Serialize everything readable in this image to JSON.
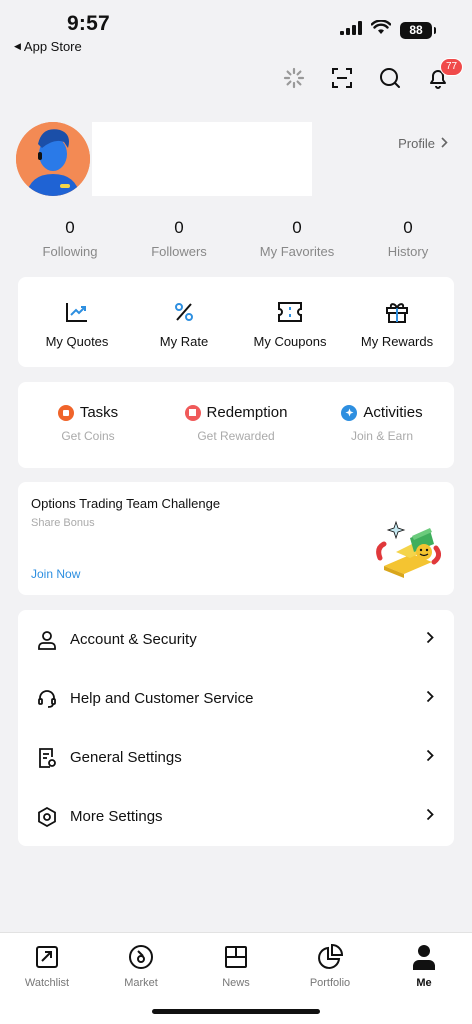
{
  "status": {
    "time": "9:57",
    "back_app": "App Store",
    "battery": "88"
  },
  "topbar": {
    "notification_count": "77"
  },
  "profile": {
    "link_label": "Profile"
  },
  "stats": [
    {
      "value": "0",
      "label": "Following"
    },
    {
      "value": "0",
      "label": "Followers"
    },
    {
      "value": "0",
      "label": "My Favorites"
    },
    {
      "value": "0",
      "label": "History"
    }
  ],
  "quick_actions": [
    {
      "label": "My Quotes",
      "icon": "chart-line-icon"
    },
    {
      "label": "My Rate",
      "icon": "percent-icon"
    },
    {
      "label": "My Coupons",
      "icon": "coupon-icon"
    },
    {
      "label": "My Rewards",
      "icon": "gift-icon"
    }
  ],
  "earn": [
    {
      "title": "Tasks",
      "subtitle": "Get Coins",
      "color": "#f0642a"
    },
    {
      "title": "Redemption",
      "subtitle": "Get Rewarded",
      "color": "#f05a5a"
    },
    {
      "title": "Activities",
      "subtitle": "Join & Earn",
      "color": "#2e8fe0"
    }
  ],
  "promo": {
    "title": "Options Trading Team Challenge",
    "subtitle": "Share Bonus",
    "cta": "Join Now"
  },
  "menu": [
    {
      "label": "Account & Security",
      "icon": "user-icon"
    },
    {
      "label": "Help and Customer Service",
      "icon": "headset-icon"
    },
    {
      "label": "General Settings",
      "icon": "settings-doc-icon"
    },
    {
      "label": "More Settings",
      "icon": "hexagon-gear-icon"
    }
  ],
  "tabs": [
    {
      "label": "Watchlist",
      "icon": "watchlist-icon",
      "active": false
    },
    {
      "label": "Market",
      "icon": "market-icon",
      "active": false
    },
    {
      "label": "News",
      "icon": "news-icon",
      "active": false
    },
    {
      "label": "Portfolio",
      "icon": "portfolio-icon",
      "active": false
    },
    {
      "label": "Me",
      "icon": "me-icon",
      "active": true
    }
  ],
  "colors": {
    "accent": "#2e8fe0",
    "badge": "#f04a4a",
    "avatar_bg": "#f38a54"
  }
}
